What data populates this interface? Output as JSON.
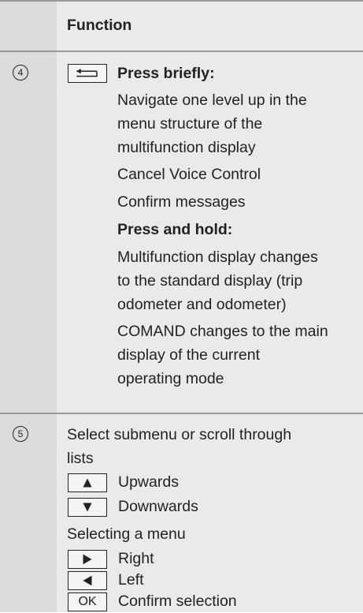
{
  "header": {
    "function_label": "Function"
  },
  "row4": {
    "number": "4",
    "key_icon": "back-arrow-icon",
    "press_briefly_label": "Press briefly:",
    "briefly_lines": [
      "Navigate one level up in the",
      "menu structure of the",
      "multifunction display",
      "Cancel Voice Control",
      "Confirm messages"
    ],
    "press_hold_label": "Press and hold:",
    "hold_lines": [
      "Multifunction display changes",
      "to the standard display (trip",
      "odometer and odometer)",
      "COMAND changes to the main",
      "display of the current",
      "operating mode"
    ]
  },
  "row5": {
    "number": "5",
    "intro_lines": [
      "Select submenu or scroll through",
      "lists"
    ],
    "up_icon": "triangle-up-icon",
    "up_label": "Upwards",
    "down_icon": "triangle-down-icon",
    "down_label": "Downwards",
    "selecting_label": "Selecting a menu",
    "right_icon": "triangle-right-icon",
    "right_label": "Right",
    "left_icon": "triangle-left-icon",
    "left_label": "Left",
    "ok_key": "OK",
    "confirm_label": "Confirm selection"
  }
}
